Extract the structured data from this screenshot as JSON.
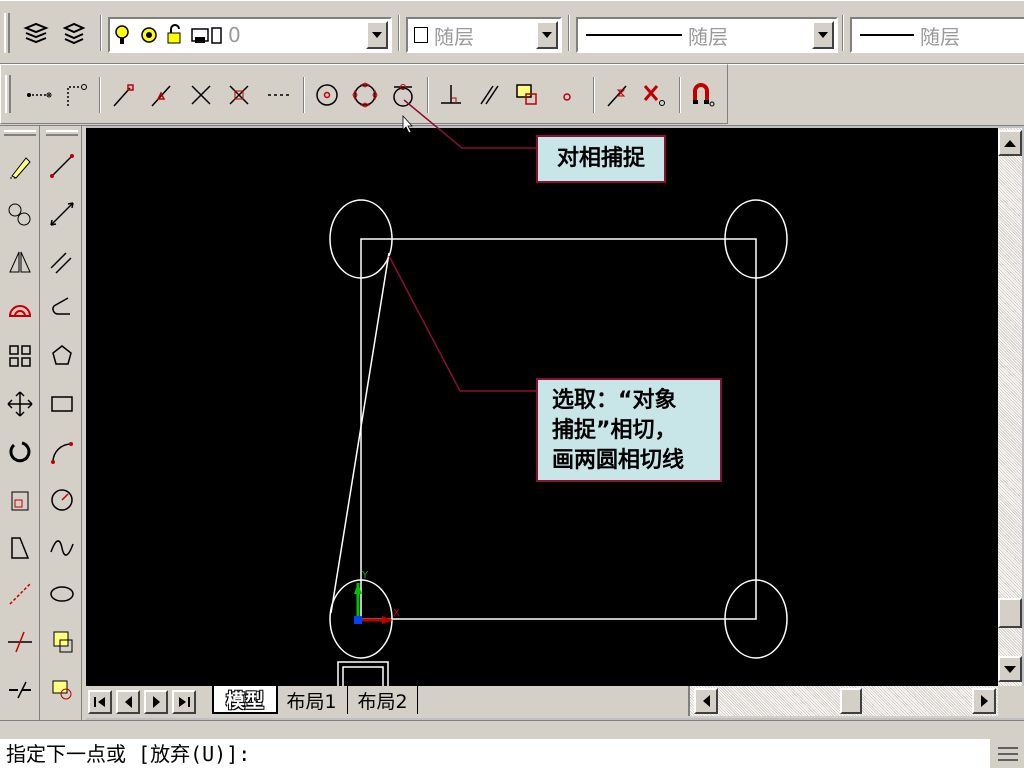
{
  "toolbar": {
    "layer_combo": {
      "value": "0"
    },
    "color_combo": {
      "value": "随层"
    },
    "linetype_combo": {
      "value": "随层"
    },
    "lineweight_combo": {
      "value": "随层"
    }
  },
  "model_tabs": [
    "模型",
    "布局1",
    "布局2"
  ],
  "annotations": {
    "snap_label": "对相捕捉",
    "tangent_note_lines": [
      "选取：“对象",
      "捕捉”相切，",
      "画两圆相切线"
    ]
  },
  "ucs": {
    "x_label": "X",
    "y_label": "Y"
  },
  "command_line": {
    "text": "指定下一点或 [放弃(U)]:"
  },
  "colors": {
    "canvas": "#000000",
    "callout_bg": "#c8e6e8",
    "callout_border": "#8a1030",
    "ui_gray": "#d4d0c8"
  }
}
